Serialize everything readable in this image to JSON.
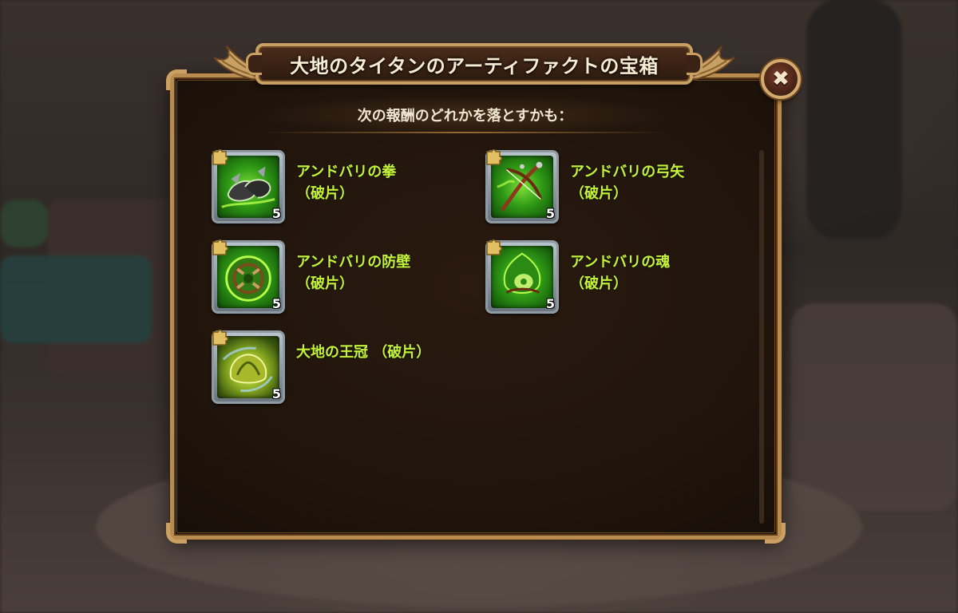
{
  "dialog": {
    "title": "大地のタイタンのアーティファクトの宝箱",
    "subtitle": "次の報酬のどれかを落とすかも：",
    "close_label": "✖"
  },
  "rewards": [
    {
      "name": "アンドバリの拳",
      "suffix": "（破片）",
      "count": "5",
      "icon": "andvari-fist-fragment-icon"
    },
    {
      "name": "アンドバリの弓矢",
      "suffix": "（破片）",
      "count": "5",
      "icon": "andvari-bow-fragment-icon"
    },
    {
      "name": "アンドバリの防壁",
      "suffix": "（破片）",
      "count": "5",
      "icon": "andvari-shield-fragment-icon"
    },
    {
      "name": "アンドバリの魂",
      "suffix": "（破片）",
      "count": "5",
      "icon": "andvari-soul-fragment-icon"
    },
    {
      "name": "大地の王冠 （破片）",
      "suffix": "",
      "count": "5",
      "icon": "earth-crown-fragment-icon"
    }
  ],
  "colors": {
    "reward_name": "#c6f23a",
    "frame_gold": "#c9a063",
    "panel_bg": "#1f140b",
    "artifact_green": "#2f9a15"
  }
}
